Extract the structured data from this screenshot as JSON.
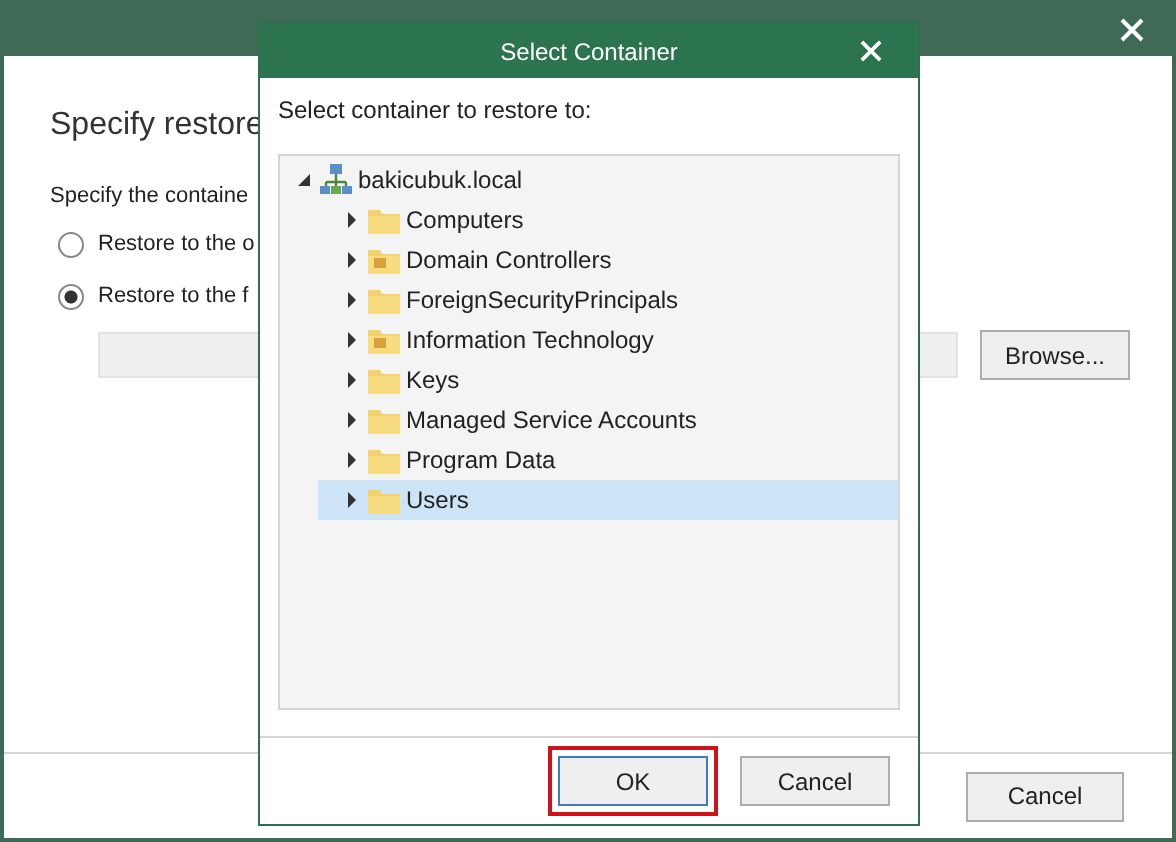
{
  "wizard": {
    "heading": "Specify restore",
    "prompt": "Specify the containe",
    "options": [
      {
        "label": "Restore to the o",
        "selected": false
      },
      {
        "label": "Restore to the f",
        "selected": true
      }
    ],
    "browse_button": "Browse...",
    "cancel_button": "Cancel"
  },
  "dialog": {
    "title": "Select Container",
    "prompt": "Select container to restore to:",
    "tree": {
      "label": "bakicubuk.local",
      "expanded": true,
      "children": [
        {
          "label": "Computers",
          "kind": "folder",
          "expanded": false,
          "selected": false
        },
        {
          "label": "Domain Controllers",
          "kind": "ou",
          "expanded": false,
          "selected": false
        },
        {
          "label": "ForeignSecurityPrincipals",
          "kind": "folder",
          "expanded": false,
          "selected": false
        },
        {
          "label": "Information Technology",
          "kind": "ou",
          "expanded": false,
          "selected": false
        },
        {
          "label": "Keys",
          "kind": "folder",
          "expanded": false,
          "selected": false
        },
        {
          "label": "Managed Service Accounts",
          "kind": "folder",
          "expanded": false,
          "selected": false
        },
        {
          "label": "Program Data",
          "kind": "folder",
          "expanded": false,
          "selected": false
        },
        {
          "label": "Users",
          "kind": "folder",
          "expanded": false,
          "selected": true
        }
      ]
    },
    "buttons": [
      {
        "label": "OK",
        "highlighted": true
      },
      {
        "label": "Cancel",
        "highlighted": false
      }
    ]
  }
}
